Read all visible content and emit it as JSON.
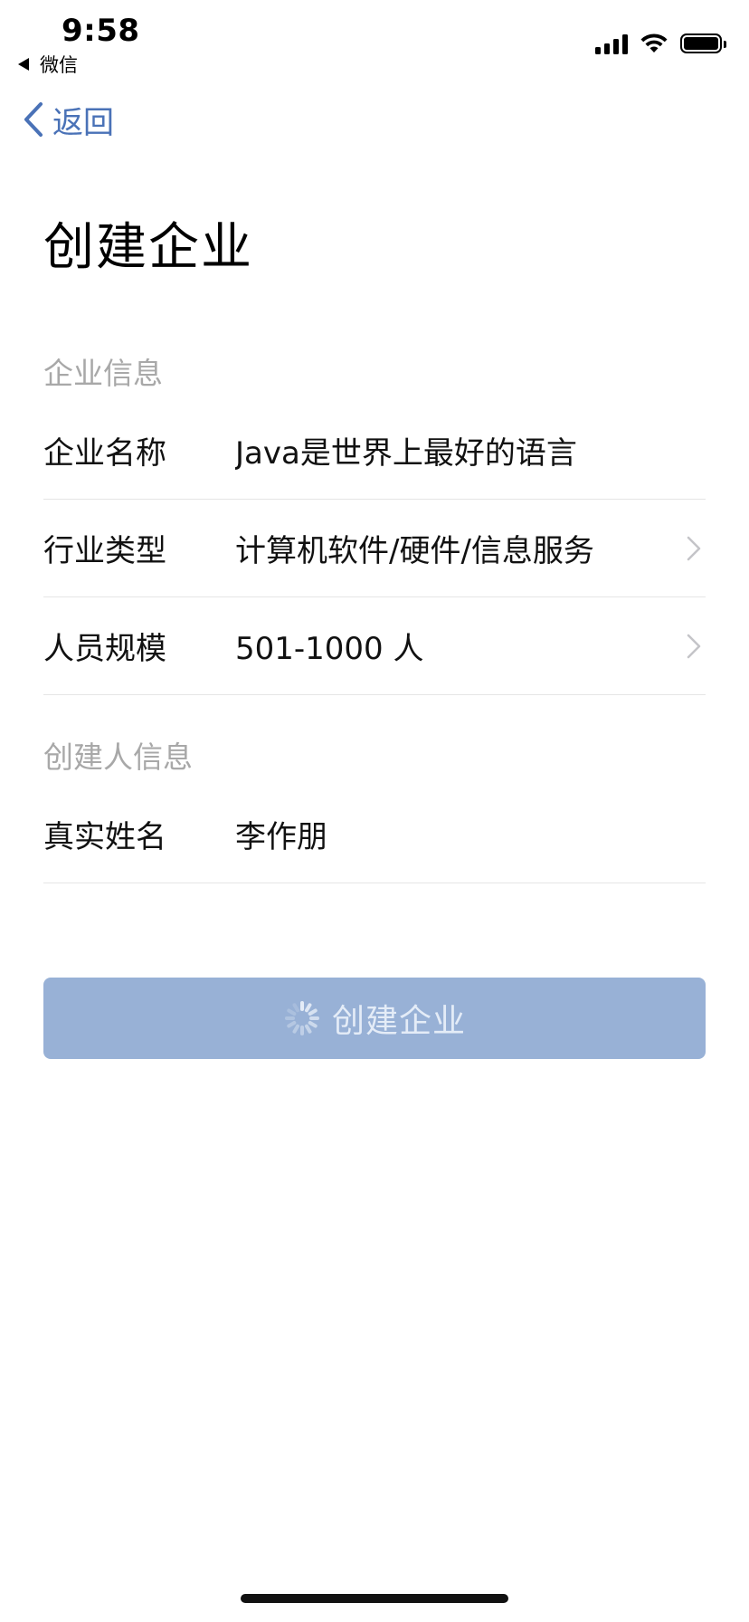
{
  "status_bar": {
    "time": "9:58",
    "back_app": "微信"
  },
  "nav": {
    "back_label": "返回"
  },
  "page": {
    "title": "创建企业"
  },
  "company_section": {
    "header": "企业信息",
    "rows": [
      {
        "label": "企业名称",
        "value": "Java是世界上最好的语言",
        "has_chevron": false
      },
      {
        "label": "行业类型",
        "value": "计算机软件/硬件/信息服务",
        "has_chevron": true
      },
      {
        "label": "人员规模",
        "value": "501-1000 人",
        "has_chevron": true
      }
    ]
  },
  "creator_section": {
    "header": "创建人信息",
    "rows": [
      {
        "label": "真实姓名",
        "value": "李作朋",
        "has_chevron": false
      }
    ]
  },
  "create_button": {
    "label": "创建企业",
    "loading": true,
    "color": "#98b1d6"
  },
  "colors": {
    "accent": "#4a72b7",
    "section_header": "#a8a8a8",
    "divider": "#e5e5e5"
  },
  "icons": {
    "back": "chevron-left-icon",
    "row_arrow": "chevron-right-icon",
    "loading": "spinner-icon"
  }
}
